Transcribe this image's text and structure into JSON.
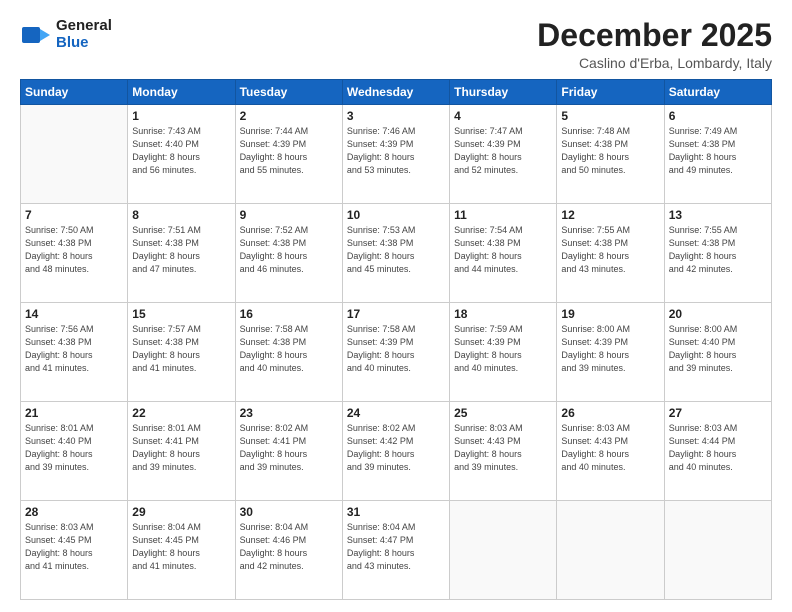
{
  "logo": {
    "line1": "General",
    "line2": "Blue",
    "tagline": "Blue"
  },
  "header": {
    "month": "December 2025",
    "location": "Caslino d'Erba, Lombardy, Italy"
  },
  "weekdays": [
    "Sunday",
    "Monday",
    "Tuesday",
    "Wednesday",
    "Thursday",
    "Friday",
    "Saturday"
  ],
  "weeks": [
    [
      {
        "day": "",
        "info": ""
      },
      {
        "day": "1",
        "info": "Sunrise: 7:43 AM\nSunset: 4:40 PM\nDaylight: 8 hours\nand 56 minutes."
      },
      {
        "day": "2",
        "info": "Sunrise: 7:44 AM\nSunset: 4:39 PM\nDaylight: 8 hours\nand 55 minutes."
      },
      {
        "day": "3",
        "info": "Sunrise: 7:46 AM\nSunset: 4:39 PM\nDaylight: 8 hours\nand 53 minutes."
      },
      {
        "day": "4",
        "info": "Sunrise: 7:47 AM\nSunset: 4:39 PM\nDaylight: 8 hours\nand 52 minutes."
      },
      {
        "day": "5",
        "info": "Sunrise: 7:48 AM\nSunset: 4:38 PM\nDaylight: 8 hours\nand 50 minutes."
      },
      {
        "day": "6",
        "info": "Sunrise: 7:49 AM\nSunset: 4:38 PM\nDaylight: 8 hours\nand 49 minutes."
      }
    ],
    [
      {
        "day": "7",
        "info": "Sunrise: 7:50 AM\nSunset: 4:38 PM\nDaylight: 8 hours\nand 48 minutes."
      },
      {
        "day": "8",
        "info": "Sunrise: 7:51 AM\nSunset: 4:38 PM\nDaylight: 8 hours\nand 47 minutes."
      },
      {
        "day": "9",
        "info": "Sunrise: 7:52 AM\nSunset: 4:38 PM\nDaylight: 8 hours\nand 46 minutes."
      },
      {
        "day": "10",
        "info": "Sunrise: 7:53 AM\nSunset: 4:38 PM\nDaylight: 8 hours\nand 45 minutes."
      },
      {
        "day": "11",
        "info": "Sunrise: 7:54 AM\nSunset: 4:38 PM\nDaylight: 8 hours\nand 44 minutes."
      },
      {
        "day": "12",
        "info": "Sunrise: 7:55 AM\nSunset: 4:38 PM\nDaylight: 8 hours\nand 43 minutes."
      },
      {
        "day": "13",
        "info": "Sunrise: 7:55 AM\nSunset: 4:38 PM\nDaylight: 8 hours\nand 42 minutes."
      }
    ],
    [
      {
        "day": "14",
        "info": "Sunrise: 7:56 AM\nSunset: 4:38 PM\nDaylight: 8 hours\nand 41 minutes."
      },
      {
        "day": "15",
        "info": "Sunrise: 7:57 AM\nSunset: 4:38 PM\nDaylight: 8 hours\nand 41 minutes."
      },
      {
        "day": "16",
        "info": "Sunrise: 7:58 AM\nSunset: 4:38 PM\nDaylight: 8 hours\nand 40 minutes."
      },
      {
        "day": "17",
        "info": "Sunrise: 7:58 AM\nSunset: 4:39 PM\nDaylight: 8 hours\nand 40 minutes."
      },
      {
        "day": "18",
        "info": "Sunrise: 7:59 AM\nSunset: 4:39 PM\nDaylight: 8 hours\nand 40 minutes."
      },
      {
        "day": "19",
        "info": "Sunrise: 8:00 AM\nSunset: 4:39 PM\nDaylight: 8 hours\nand 39 minutes."
      },
      {
        "day": "20",
        "info": "Sunrise: 8:00 AM\nSunset: 4:40 PM\nDaylight: 8 hours\nand 39 minutes."
      }
    ],
    [
      {
        "day": "21",
        "info": "Sunrise: 8:01 AM\nSunset: 4:40 PM\nDaylight: 8 hours\nand 39 minutes."
      },
      {
        "day": "22",
        "info": "Sunrise: 8:01 AM\nSunset: 4:41 PM\nDaylight: 8 hours\nand 39 minutes."
      },
      {
        "day": "23",
        "info": "Sunrise: 8:02 AM\nSunset: 4:41 PM\nDaylight: 8 hours\nand 39 minutes."
      },
      {
        "day": "24",
        "info": "Sunrise: 8:02 AM\nSunset: 4:42 PM\nDaylight: 8 hours\nand 39 minutes."
      },
      {
        "day": "25",
        "info": "Sunrise: 8:03 AM\nSunset: 4:43 PM\nDaylight: 8 hours\nand 39 minutes."
      },
      {
        "day": "26",
        "info": "Sunrise: 8:03 AM\nSunset: 4:43 PM\nDaylight: 8 hours\nand 40 minutes."
      },
      {
        "day": "27",
        "info": "Sunrise: 8:03 AM\nSunset: 4:44 PM\nDaylight: 8 hours\nand 40 minutes."
      }
    ],
    [
      {
        "day": "28",
        "info": "Sunrise: 8:03 AM\nSunset: 4:45 PM\nDaylight: 8 hours\nand 41 minutes."
      },
      {
        "day": "29",
        "info": "Sunrise: 8:04 AM\nSunset: 4:45 PM\nDaylight: 8 hours\nand 41 minutes."
      },
      {
        "day": "30",
        "info": "Sunrise: 8:04 AM\nSunset: 4:46 PM\nDaylight: 8 hours\nand 42 minutes."
      },
      {
        "day": "31",
        "info": "Sunrise: 8:04 AM\nSunset: 4:47 PM\nDaylight: 8 hours\nand 43 minutes."
      },
      {
        "day": "",
        "info": ""
      },
      {
        "day": "",
        "info": ""
      },
      {
        "day": "",
        "info": ""
      }
    ]
  ]
}
